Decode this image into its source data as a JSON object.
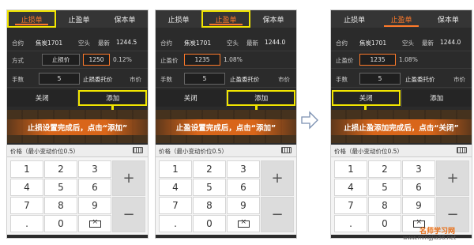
{
  "tabs": [
    "止损单",
    "止盈单",
    "保本单"
  ],
  "p1": {
    "r1": {
      "l1": "合约",
      "v1": "焦炭1701",
      "v2": "空头",
      "l3": "最新",
      "v3": "1244.5"
    },
    "r2": {
      "l1": "方式",
      "f1": "止损价",
      "f2": "1250",
      "v": "0.12%"
    },
    "r3": {
      "l1": "手数",
      "f": "5",
      "l2": "止损委托价",
      "l3": "市价"
    },
    "btns": [
      "关闭",
      "添加"
    ],
    "caption": "止损设置完成后，点击“添加”"
  },
  "p2": {
    "r1": {
      "l1": "合约",
      "v1": "焦炭1701",
      "v2": "空头",
      "l3": "最新",
      "v3": "1244.0"
    },
    "r2": {
      "l1": "止盈价",
      "f": "1235",
      "v": "1.08%"
    },
    "r3": {
      "l1": "手数",
      "f": "5",
      "l2": "止盈委托价",
      "l3": "市价"
    },
    "btns": [
      "关闭",
      "添加"
    ],
    "caption": "止盈设置完成后，点击“添加”"
  },
  "p3": {
    "r1": {
      "l1": "合约",
      "v1": "焦炭1701",
      "v2": "空头",
      "l3": "最新",
      "v3": "1244.0"
    },
    "r2": {
      "l1": "止盈价",
      "f": "1235",
      "v": "1.08%"
    },
    "r3": {
      "l1": "手数",
      "f": "5",
      "l2": "止盈委托价",
      "l3": "市价"
    },
    "btns": [
      "关闭",
      "添加"
    ],
    "caption": "止损止盈添加完成后，点击“关闭”"
  },
  "keyboard_bar": "价格（最小变动价位0.5）",
  "keys": [
    "1",
    "2",
    "3",
    "4",
    "5",
    "6",
    "7",
    "8",
    "9",
    ".",
    "0"
  ],
  "side_keys": [
    "+",
    "−"
  ],
  "watermark": {
    "brand": "名师学习网",
    "url": "www.mingjia56.net"
  },
  "colors": {
    "accent": "#ff7a2a",
    "highlight": "#f2e600",
    "caption_band": "#d9661a"
  }
}
